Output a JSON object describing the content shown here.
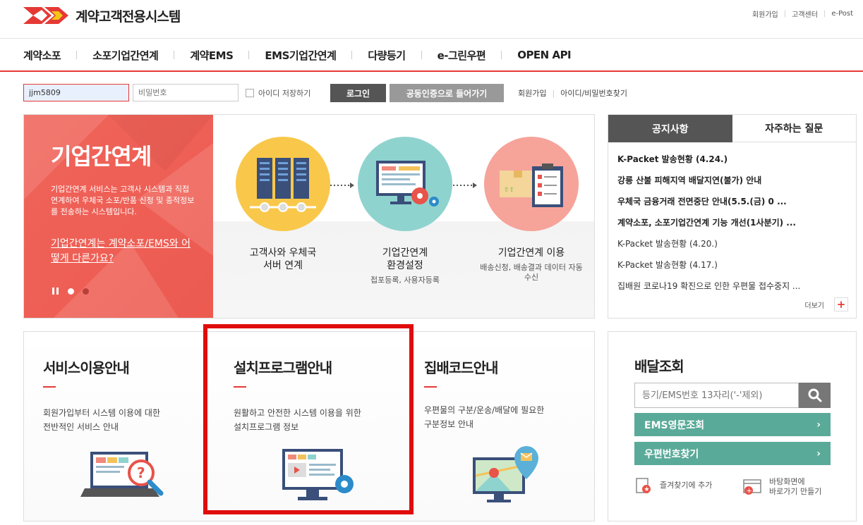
{
  "header": {
    "title": "계약고객전용시스템",
    "links": [
      "회원가입",
      "고객센터",
      "e-Post"
    ]
  },
  "gnb": [
    "계약소포",
    "소포기업간연계",
    "계약EMS",
    "EMS기업간연계",
    "다량등기",
    "e-그린우편",
    "OPEN API"
  ],
  "login": {
    "id_value": "jjm5809",
    "pw_placeholder": "비밀번호",
    "save_id": "아이디 저장하기",
    "login_btn": "로그인",
    "cert_btn": "공동인증으로 들어가기",
    "join": "회원가입",
    "find": "아이디/비밀번호찾기"
  },
  "banner": {
    "title": "기업간연계",
    "desc": "기업간연계 서비스는 고객사 시스템과 직접연계하여 우체국 소포/반품 신청 및 종적정보를 전송하는 시스템입니다.",
    "link": "기업간연계는 계약소포/EMS와 어떻게 다른가요?",
    "steps": [
      {
        "name_1": "고객사와 우체국",
        "name_2": "서버 연계",
        "sub": ""
      },
      {
        "name_1": "기업간연계",
        "name_2": "환경설정",
        "sub": "접포등록, 사용자등록"
      },
      {
        "name_1": "기업간연계 이용",
        "name_2": "",
        "sub": "배송신청, 배송결과 데이터 자동수신"
      }
    ]
  },
  "notice": {
    "tab_active": "공지사항",
    "tab_inactive": "자주하는 질문",
    "items": [
      "K-Packet 발송현황 (4.24.)",
      "강릉 산불 피해지역 배달지연(불가) 안내",
      "우체국 금융거래 전면중단 안내(5.5.(금) 0 ...",
      "계약소포, 소포기업간연계 기능 개선(1사분기) ...",
      "K-Packet 발송현황 (4.20.)",
      "K-Packet 발송현황 (4.17.)",
      "집배원 코로나19 확진으로 인한 우편물 접수중지 ..."
    ],
    "more": "더보기"
  },
  "guides": [
    {
      "title": "서비스이용안내",
      "desc_1": "회원가입부터 시스템 이용에 대한",
      "desc_2": "전반적인 서비스 안내"
    },
    {
      "title": "설치프로그램안내",
      "desc_1": "원활하고 안전한 시스템 이용을 위한",
      "desc_2": "설치프로그램 정보"
    },
    {
      "title": "집배코드안내",
      "desc_1": "우편물의 구분/운송/배달에 필요한",
      "desc_2": "구분정보 안내"
    }
  ],
  "delivery": {
    "title": "배달조회",
    "placeholder": "등기/EMS번호 13자리('-'제외)",
    "ems_btn": "EMS영문조회",
    "zip_btn": "우편번호찾기",
    "bookmark": "즐겨찾기에 추가",
    "desktop_1": "바탕화면에",
    "desktop_2": "바로가기 만들기"
  },
  "colors": {
    "accent": "#e53935",
    "teal": "#5aaa99",
    "highlight": "#e00c0c"
  }
}
